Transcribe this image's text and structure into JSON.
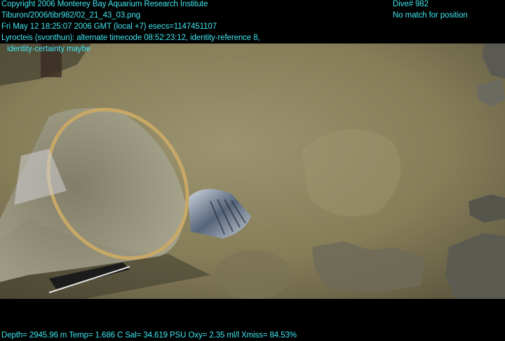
{
  "overlay": {
    "copyright": "Copyright 2006 Monterey Bay Aquarium Research Institute",
    "file_path": "Tiburon/2006/tibr982/02_21_43_03.png",
    "datetime": "Fri May 12 18:25:07 2006 GMT (local +7)  esecs=1147451107",
    "annotation_line1": "Lyrocteis (svonthun): alternate timecode 08:52:23:12, identity-reference 8,",
    "annotation_line2": "identity-certainty maybe",
    "dive": "Dive# 982",
    "position_status": "No match for position",
    "telemetry": "Depth= 2945.96 m  Temp= 1.686 C  Sal= 34.619 PSU  Oxy= 2.35 ml/l  Xmiss= 84.53%"
  },
  "colors": {
    "overlay_text": "#3fe6f0",
    "background": "#000000",
    "seafloor": "#8f8660"
  }
}
